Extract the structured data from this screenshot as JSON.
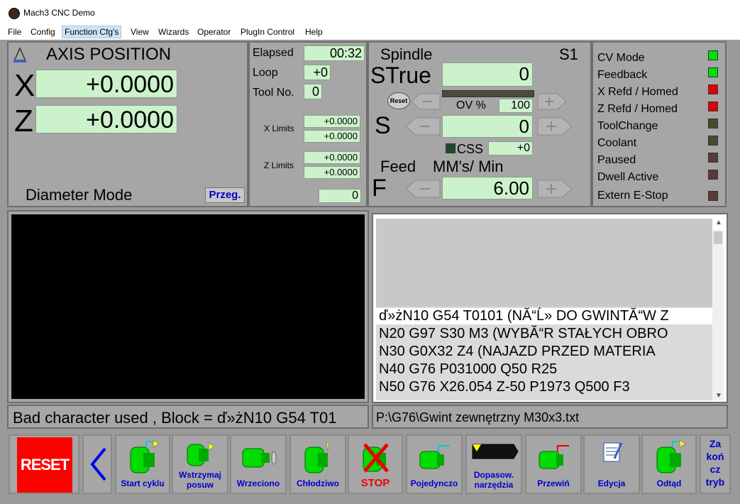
{
  "window": {
    "title": "Mach3 CNC  Demo"
  },
  "menu": [
    "File",
    "Config",
    "Function Cfg's",
    "View",
    "Wizards",
    "Operator",
    "PlugIn Control",
    "Help"
  ],
  "axis": {
    "heading": "AXIS POSITION",
    "x_label": "X",
    "x_value": "+0.0000",
    "z_label": "Z",
    "z_value": "+0.0000",
    "mode_label": "Diameter Mode",
    "przeg_label": "Przeg."
  },
  "timer": {
    "elapsed_label": "Elapsed",
    "elapsed_value": "00:32",
    "loop_label": "Loop",
    "loop_value": "+0",
    "tool_label": "Tool No.",
    "tool_value": "0",
    "xlimits_label": "X Limits",
    "xlimit_1": "+0.0000",
    "xlimit_2": "+0.0000",
    "zlimits_label": "Z Limits",
    "zlimit_1": "+0.0000",
    "zlimit_2": "+0.0000",
    "counter_value": "0"
  },
  "spindle": {
    "heading": "Spindle",
    "s1_label": "S1",
    "strue_label": "STrue",
    "strue_value": "0",
    "reset_label": "Reset",
    "ov_label": "OV %",
    "ov_value": "100",
    "s_label": "S",
    "s_value": "0",
    "css_label": "CSS",
    "css_value": "+0",
    "feed_label": "Feed",
    "feed_units": "MM's/ Min",
    "f_label": "F",
    "f_value": "6.00"
  },
  "status": {
    "items": [
      {
        "label": "CV Mode",
        "color": "#00e000"
      },
      {
        "label": "Feedback",
        "color": "#00e000"
      },
      {
        "label": "X Refd / Homed",
        "color": "#e00000"
      },
      {
        "label": "Z Refd / Homed",
        "color": "#e00000"
      },
      {
        "label": "ToolChange",
        "color": "#4a4a30"
      },
      {
        "label": "Coolant",
        "color": "#4a4a30"
      },
      {
        "label": "Paused",
        "color": "#5a3a3a"
      },
      {
        "label": "Dwell Active",
        "color": "#5a3a3a"
      },
      {
        "label": "Extern E-Stop",
        "color": "#5a3a3a"
      }
    ]
  },
  "gcode": {
    "lines": [
      "ď»żN10 G54 T0101 (NĂ“Ĺ» DO GWINTĂ“W Z",
      "N20 G97 S30 M3    (WYBĂ“R STAŁYCH OBRO",
      "N30 G0X32 Z4       (NAJAZD PRZED MATERIA",
      "N40 G76 P031000 Q50 R25",
      "N50 G76 X26.054 Z-50 P1973 Q500 F3"
    ],
    "file_path": "P:\\G76\\Gwint zewnętrzny M30x3.txt"
  },
  "error_message": "Bad character used , Block = ď»żN10 G54 T01",
  "toolbar": {
    "reset": "RESET",
    "start": "Start cyklu",
    "feedhold": "Wstrzymaj posuw",
    "spindle": "Wrzeciono",
    "coolant": "Chłodziwo",
    "stop": "STOP",
    "single": "Pojedynczo",
    "tool_fit": "Dopasow. narzędzia",
    "rewind": "Przewiń",
    "edit": "Edycja",
    "retract": "Odtąd",
    "end": "Za koń cz tryb"
  }
}
